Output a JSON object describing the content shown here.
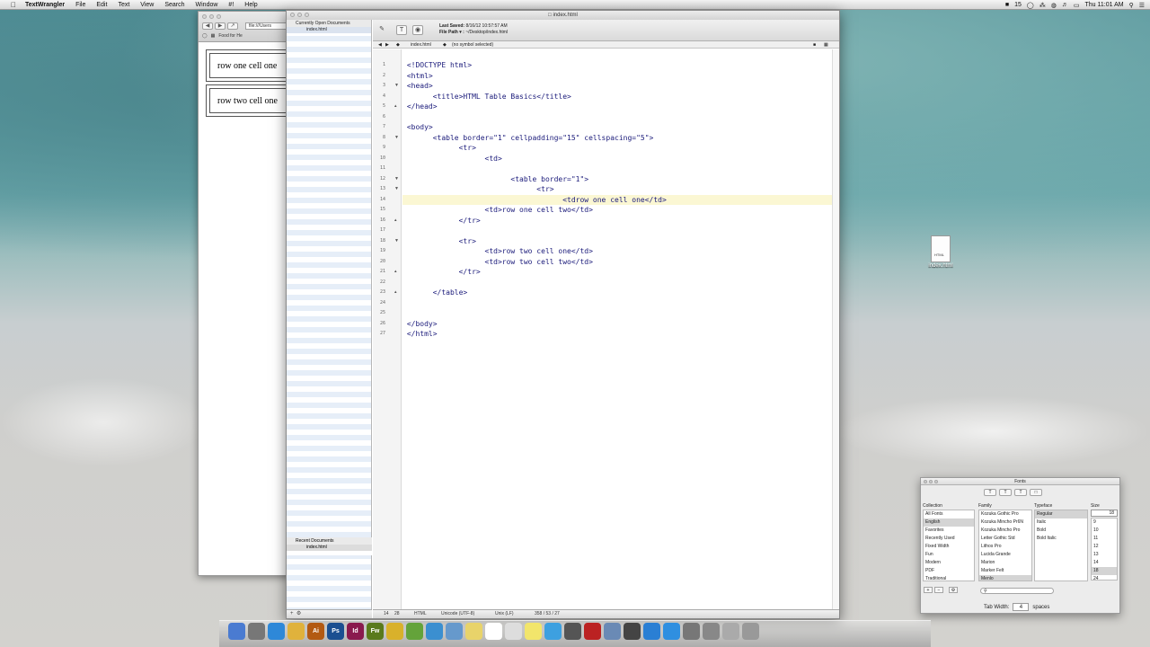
{
  "menubar": {
    "app": "TextWrangler",
    "items": [
      "File",
      "Edit",
      "Text",
      "View",
      "Search",
      "Window",
      "#!",
      "Help"
    ],
    "status": "15",
    "clock": "Thu 11:01 AM"
  },
  "browser": {
    "url": "file:///Users",
    "bookmark": "Food for He",
    "cell1": "row one cell one",
    "cell2": "row two cell one"
  },
  "editor": {
    "window_title": "index.html",
    "sidebar_header": "Currently Open Documents",
    "open_document": "index.html",
    "recent_header": "Recent Documents",
    "recent_document": "index.html",
    "last_saved_label": "Last Saved:",
    "last_saved_value": "8/16/12 10:57:57 AM",
    "file_path_label": "File Path ▾ :",
    "file_path_value": "~/Desktop/index.html",
    "nav_file": "index.html",
    "nav_symbol": "(no symbol selected)",
    "current_line": 14,
    "lines": [
      "<!DOCTYPE html>",
      "<html>",
      "<head>",
      "      <title>HTML Table Basics</title>",
      "</head>",
      "",
      "<body>",
      "      <table border=\"1\" cellpadding=\"15\" cellspacing=\"5\">",
      "            <tr>",
      "                  <td>",
      "",
      "                        <table border=\"1\">",
      "                              <tr>",
      "                                    <tdrow one cell one</td>",
      "                  <td>row one cell two</td>",
      "            </tr>",
      "",
      "            <tr>",
      "                  <td>row two cell one</td>",
      "                  <td>row two cell two</td>",
      "            </tr>",
      "",
      "      </table>",
      "",
      "",
      "</body>",
      "</html>"
    ],
    "status": {
      "cursor_line": "14",
      "cursor_col": "28",
      "language": "HTML",
      "encoding": "Unicode (UTF-8)",
      "line_endings": "Unix (LF)",
      "counts": "358 / 53 / 27"
    }
  },
  "desktop_file": {
    "label": "index.html",
    "badge": "HTML"
  },
  "fonts_panel": {
    "title": "Fonts",
    "collection_header": "Collection",
    "family_header": "Family",
    "typeface_header": "Typeface",
    "size_header": "Size",
    "collections": [
      "All Fonts",
      "English",
      "Favorites",
      "Recently Used",
      "Fixed Width",
      "Fun",
      "Modern",
      "PDF",
      "Traditional"
    ],
    "collection_selected": 1,
    "families": [
      "Kozuka Gothic Pro",
      "Kozuka Mincho Pr6N",
      "Kozuka Mincho Pro",
      "Letter Gothic Std",
      "Lithos Pro",
      "Lucida Grande",
      "Marion",
      "Marker Felt",
      "Menlo"
    ],
    "family_selected": 8,
    "typefaces": [
      "Regular",
      "Italic",
      "Bold",
      "Bold Italic"
    ],
    "typeface_selected": 0,
    "size_value": "18",
    "sizes": [
      "9",
      "10",
      "11",
      "12",
      "13",
      "14",
      "18",
      "24"
    ],
    "size_selected": 6,
    "tab_width_label": "Tab Width:",
    "tab_width_value": "4",
    "tab_width_unit": "spaces"
  },
  "dock": {
    "apps": [
      "Finder",
      "Launchpad",
      "Safari",
      "Chrome",
      "Ai",
      "Ps",
      "Id",
      "Fw",
      "Cyberduck",
      "Dreamweaver",
      "Mail",
      "Preview",
      "Notes",
      "Calendar",
      "Reminders",
      "Stickies",
      "Messages",
      "FaceTime",
      "Photo Booth",
      "iPhoto",
      "iMovie",
      "iTunes",
      "App Store",
      "System Preferences",
      "Downloads",
      "Documents",
      "Trash"
    ]
  }
}
